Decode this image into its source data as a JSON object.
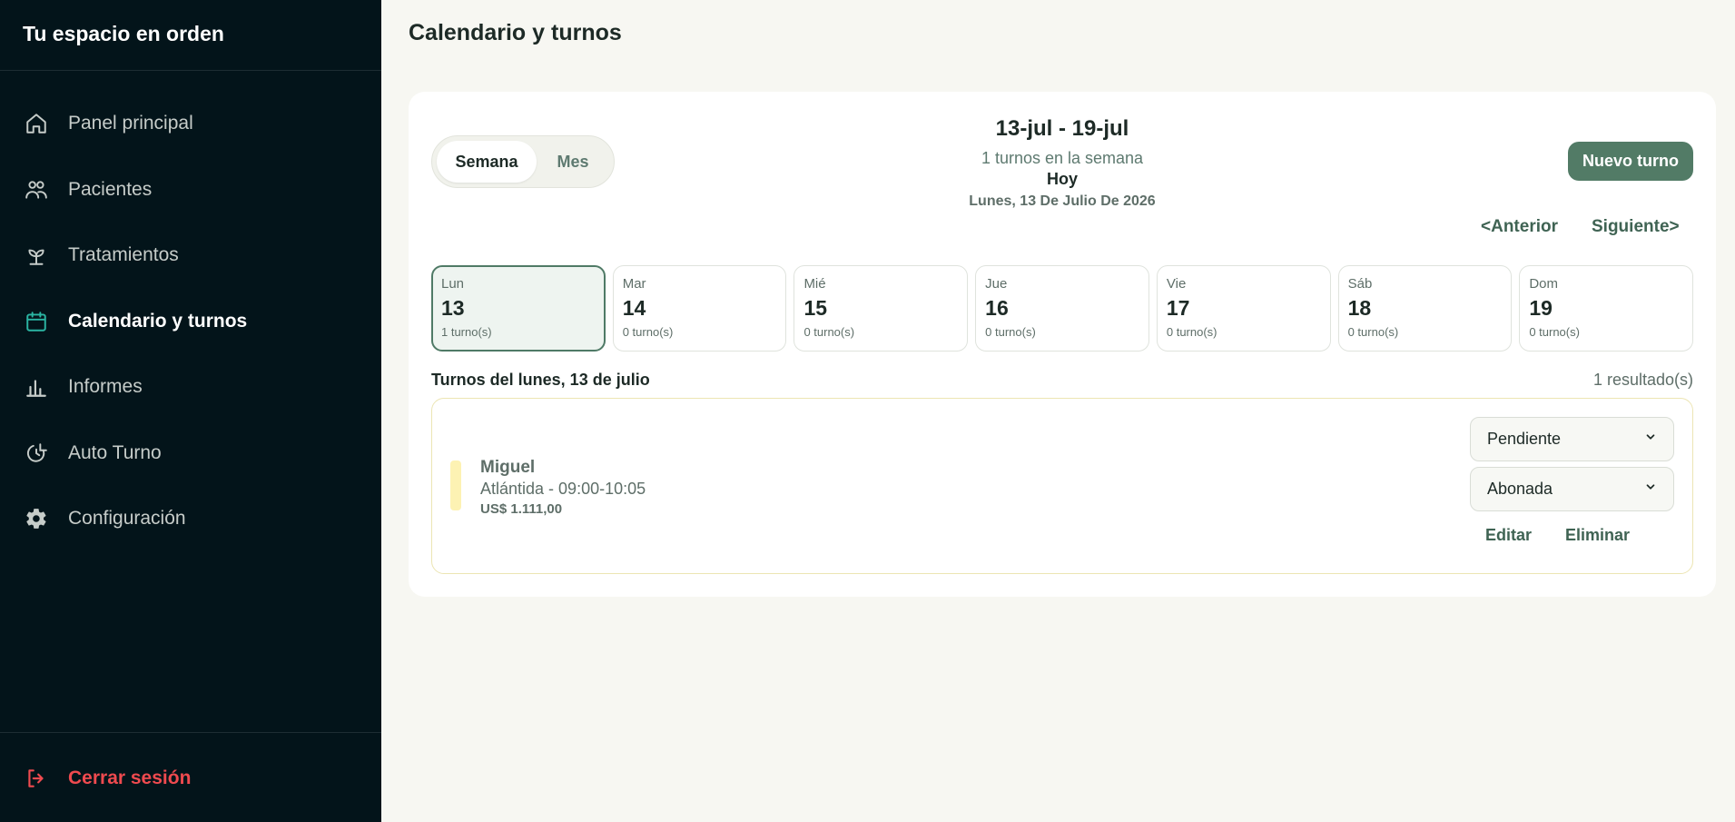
{
  "sidebar": {
    "brand": "Tu espacio en orden",
    "items": [
      {
        "label": "Panel principal",
        "icon": "home-icon",
        "active": false
      },
      {
        "label": "Pacientes",
        "icon": "users-icon",
        "active": false
      },
      {
        "label": "Tratamientos",
        "icon": "sprout-icon",
        "active": false
      },
      {
        "label": "Calendario y turnos",
        "icon": "calendar-icon",
        "active": true
      },
      {
        "label": "Informes",
        "icon": "bar-chart-icon",
        "active": false
      },
      {
        "label": "Auto Turno",
        "icon": "refresh-icon",
        "active": false
      },
      {
        "label": "Configuración",
        "icon": "gear-icon",
        "active": false
      }
    ],
    "logout_label": "Cerrar sesión",
    "colors": {
      "background": "#03141a",
      "active_icon": "#2bb5a3",
      "logout": "#ef4a4f"
    }
  },
  "page": {
    "title": "Calendario y turnos"
  },
  "calendar": {
    "view_toggle": {
      "week": "Semana",
      "month": "Mes",
      "selected": "Semana"
    },
    "range_title": "13-jul - 19-jul",
    "range_count": "1 turnos en la semana",
    "today_label": "Hoy",
    "today_date": "Lunes, 13 De Julio De 2026",
    "new_button": "Nuevo turno",
    "prev_label": "<Anterior",
    "next_label": "Siguiente>",
    "days": [
      {
        "name": "Lun",
        "num": "13",
        "count": "1 turno(s)",
        "selected": true
      },
      {
        "name": "Mar",
        "num": "14",
        "count": "0 turno(s)",
        "selected": false
      },
      {
        "name": "Mié",
        "num": "15",
        "count": "0 turno(s)",
        "selected": false
      },
      {
        "name": "Jue",
        "num": "16",
        "count": "0 turno(s)",
        "selected": false
      },
      {
        "name": "Vie",
        "num": "17",
        "count": "0 turno(s)",
        "selected": false
      },
      {
        "name": "Sáb",
        "num": "18",
        "count": "0 turno(s)",
        "selected": false
      },
      {
        "name": "Dom",
        "num": "19",
        "count": "0 turno(s)",
        "selected": false
      }
    ],
    "list_title": "Turnos del lunes, 13 de julio",
    "list_count": "1 resultado(s)",
    "appointments": [
      {
        "patient": "Miguel",
        "time": "Atlántida - 09:00-10:05",
        "price": "US$ 1.111,00",
        "status": "Pendiente",
        "payment": "Abonada",
        "edit_label": "Editar",
        "delete_label": "Eliminar"
      }
    ],
    "colors": {
      "accent": "#527b66",
      "status_bar": "#fdf2b3"
    }
  }
}
